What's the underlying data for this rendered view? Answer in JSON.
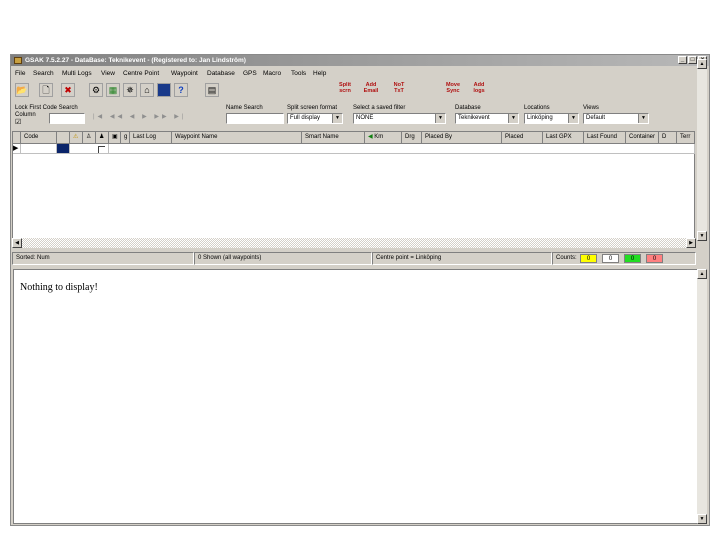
{
  "window": {
    "title": "GSAK 7.5.2.27 - DataBase: Teknikevent - (Registered to: Jan Lindström)",
    "buttons": {
      "minimize": "_",
      "maximize": "□",
      "close": "x"
    }
  },
  "menu": [
    "File",
    "Search",
    "Multi Logs",
    "View",
    "Centre Point",
    "Waypoint",
    "Database",
    "GPS",
    "Macro",
    "Tools",
    "Help"
  ],
  "toolbar": {
    "buttons": [
      "open-folder",
      "new-page",
      "delete-x",
      "tools",
      "grid",
      "globe",
      "home",
      "window",
      "help"
    ],
    "icons": {
      "open": "📂",
      "new": "🗋",
      "delete": "✖",
      "tools": "⚙",
      "grid": "▦",
      "globe": "✵",
      "home": "⌂",
      "help": "?",
      "print": "▤"
    },
    "nav_buttons": [
      "|◀",
      "◀◀",
      "◀",
      "▶",
      "▶▶",
      "▶|"
    ],
    "split_label": "Split\nscrn",
    "add_email_label": "Add\nEmail",
    "no_txt_label": "NoT\nTxT",
    "move_sync_label": "Move\nSync",
    "add_notes_label": "Add\nlogs"
  },
  "filters": {
    "lock_label": "Lock First Code Search",
    "column_label": "Column",
    "name_search_label": "Name Search",
    "split_format_label": "Split screen format",
    "split_format_value": "Full display",
    "saved_filter_label": "Select a saved filter",
    "saved_filter_value": "NONE",
    "database_label": "Database",
    "database_value": "Teknikevent",
    "locations_label": "Locations",
    "locations_value": "Linköping",
    "views_label": "Views",
    "views_value": "Default",
    "dropdown_arrow": "▼",
    "checkbox": "☑"
  },
  "grid": {
    "columns": [
      "Code",
      "",
      "",
      "",
      "",
      "",
      "g",
      "Last Log",
      "Waypoint Name",
      "Smart Name",
      "Km",
      "Drg",
      "Placed By",
      "Placed",
      "Last GPX",
      "Last Found",
      "Container",
      "D",
      "Terr"
    ],
    "row_marker": "▶"
  },
  "status": {
    "sorted": "Sorted: Num",
    "shown": "0 Shown (all waypoints)",
    "centre": "Centre point = Linköping",
    "counts_label": "Counts:",
    "counts": [
      "0",
      "0",
      "0",
      "0"
    ],
    "count_colors": [
      "#ffff00",
      "#ffffff",
      "#22dd22",
      "#ff8080"
    ]
  },
  "pane": {
    "message": "Nothing to display!"
  },
  "scroll": {
    "up": "▲",
    "down": "▼",
    "left": "◀",
    "right": "▶"
  }
}
